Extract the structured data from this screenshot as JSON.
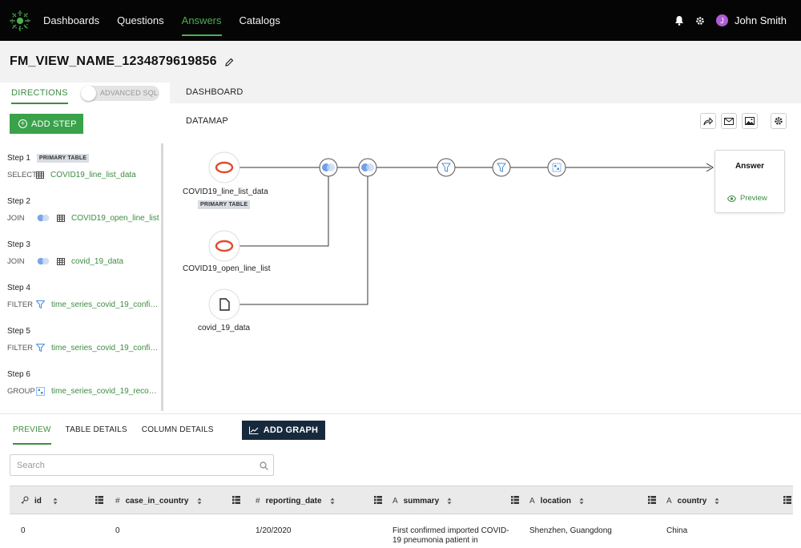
{
  "nav": {
    "items": [
      "Dashboards",
      "Questions",
      "Answers",
      "Catalogs"
    ],
    "active": "Answers",
    "user": {
      "initial": "J",
      "name": "John Smith"
    },
    "accent_color": "#4caf50"
  },
  "page": {
    "title": "FM_VIEW_NAME_1234879619856"
  },
  "left_panel": {
    "tab": "DIRECTIONS",
    "advanced_sql_label": "ADVANCED SQL",
    "add_step_label": "ADD STEP",
    "steps": [
      {
        "label": "Step 1",
        "badge": "PRIMARY TABLE",
        "kind": "SELECT",
        "icon": "table-icon",
        "target": "COVID19_line_list_data"
      },
      {
        "label": "Step 2",
        "kind": "JOIN",
        "icon": "join-icon",
        "target": "COVID19_open_line_list"
      },
      {
        "label": "Step 3",
        "kind": "JOIN",
        "icon": "join-icon",
        "target": "covid_19_data"
      },
      {
        "label": "Step 4",
        "kind": "FILTER",
        "icon": "filter-icon",
        "target": "time_series_covid_19_confir..."
      },
      {
        "label": "Step 5",
        "kind": "FILTER",
        "icon": "filter-icon",
        "target": "time_series_covid_19_confir..."
      },
      {
        "label": "Step 6",
        "kind": "GROUP",
        "icon": "group-icon",
        "target": "time_series_covid_19_recov..."
      }
    ]
  },
  "dashboard": {
    "tab": "DASHBOARD",
    "datamap_label": "DATAMAP",
    "nodes": [
      {
        "label": "COVID19_line_list_data",
        "badge": "PRIMARY TABLE",
        "icon": "database-icon"
      },
      {
        "label": "COVID19_open_line_list",
        "icon": "database-icon"
      },
      {
        "label": "covid_19_data",
        "icon": "file-icon"
      }
    ],
    "answer": {
      "title": "Answer",
      "preview": "Preview"
    }
  },
  "bottom": {
    "tabs": [
      "PREVIEW",
      "TABLE DETAILS",
      "COLUMN DETAILS"
    ],
    "active_tab": "PREVIEW",
    "add_graph_label": "ADD GRAPH",
    "search_placeholder": "Search",
    "columns": [
      {
        "type_icon": "key-icon",
        "name": "id"
      },
      {
        "type_icon": "#",
        "name": "case_in_country"
      },
      {
        "type_icon": "#",
        "name": "reporting_date"
      },
      {
        "type_icon": "A",
        "name": "summary"
      },
      {
        "type_icon": "A",
        "name": "location"
      },
      {
        "type_icon": "A",
        "name": "country"
      }
    ],
    "rows": [
      [
        "0",
        "0",
        "1/20/2020",
        "First confirmed imported COVID-19 pneumonia patient in",
        "Shenzhen, Guangdong",
        "China"
      ]
    ]
  }
}
